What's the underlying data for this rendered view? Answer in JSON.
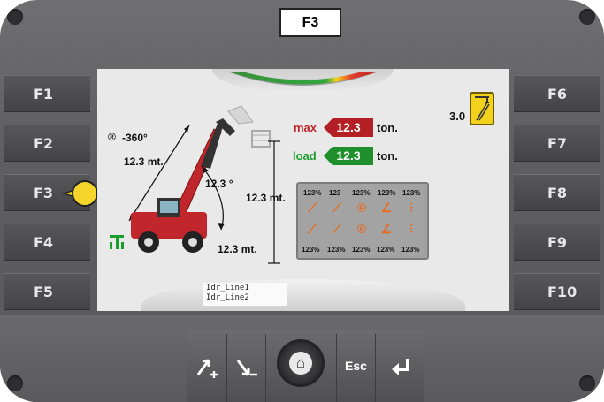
{
  "context_label": "F3",
  "fkeys_left": [
    "F1",
    "F2",
    "F3",
    "F4",
    "F5"
  ],
  "fkeys_right": [
    "F6",
    "F7",
    "F8",
    "F9",
    "F10"
  ],
  "screen": {
    "rotation": "-360°",
    "boom_length": "12.3 mt.",
    "boom_angle": "12.3 °",
    "height": "12.3 mt.",
    "reach": "12.3 mt.",
    "max_label": "max",
    "max_value": "12.3",
    "max_unit": "ton.",
    "load_label": "load",
    "load_value": "12.3",
    "load_unit": "ton.",
    "ratio_value": "3.0",
    "grid_top": [
      "123%",
      "123",
      "123%",
      "123%",
      "123%"
    ],
    "grid_bottom": [
      "123%",
      "123%",
      "123%",
      "123%",
      "123%"
    ],
    "idr_line1": "Idr_Line1",
    "idr_line2": "Idr_Line2",
    "status_gauge": [
      "#1e9d3a",
      "#f2d21c",
      "#e0402c"
    ]
  },
  "controls": {
    "esc": "Esc",
    "plus_icon": "increase-icon",
    "minus_icon": "decrease-icon",
    "home_icon": "home-icon",
    "enter_icon": "enter-icon"
  }
}
